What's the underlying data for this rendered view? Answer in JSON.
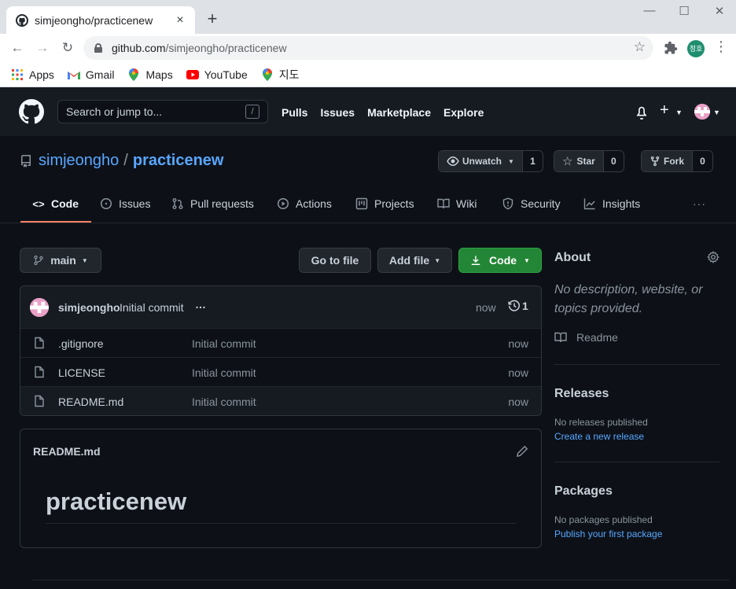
{
  "browser": {
    "tab_title": "simjeongho/practicenew",
    "tab_close": "×",
    "new_tab": "+",
    "url_host": "github.com",
    "url_path": "/simjeongho/practicenew",
    "profile_initials": "정호",
    "bookmarks": [
      {
        "label": "Apps",
        "icon": "apps-grid-icon"
      },
      {
        "label": "Gmail",
        "icon": "gmail-icon"
      },
      {
        "label": "Maps",
        "icon": "maps-pin-icon"
      },
      {
        "label": "YouTube",
        "icon": "youtube-icon"
      },
      {
        "label": "지도",
        "icon": "maps-pin-icon"
      }
    ]
  },
  "header": {
    "search_placeholder": "Search or jump to...",
    "search_shortcut": "/",
    "nav": [
      "Pulls",
      "Issues",
      "Marketplace",
      "Explore"
    ]
  },
  "repo": {
    "owner": "simjeongho",
    "separator": "/",
    "name": "practicenew",
    "watch_label": "Unwatch",
    "watch_count": "1",
    "star_label": "Star",
    "star_count": "0",
    "fork_label": "Fork",
    "fork_count": "0"
  },
  "tabs": [
    {
      "label": "Code",
      "icon": "code-icon"
    },
    {
      "label": "Issues",
      "icon": "issue-opened-icon"
    },
    {
      "label": "Pull requests",
      "icon": "git-pull-request-icon"
    },
    {
      "label": "Actions",
      "icon": "play-icon"
    },
    {
      "label": "Projects",
      "icon": "project-icon"
    },
    {
      "label": "Wiki",
      "icon": "book-icon"
    },
    {
      "label": "Security",
      "icon": "shield-icon"
    },
    {
      "label": "Insights",
      "icon": "graph-icon"
    }
  ],
  "tabs_more": "···",
  "toolbar": {
    "branch": "main",
    "go_to_file": "Go to file",
    "add_file": "Add file",
    "code": "Code"
  },
  "commit": {
    "author": "simjeongho",
    "message": "Initial commit",
    "more": "…",
    "when": "now",
    "history_count": "1"
  },
  "files": [
    {
      "name": ".gitignore",
      "message": "Initial commit",
      "when": "now"
    },
    {
      "name": "LICENSE",
      "message": "Initial commit",
      "when": "now"
    },
    {
      "name": "README.md",
      "message": "Initial commit",
      "when": "now"
    }
  ],
  "readme": {
    "filename": "README.md",
    "heading": "practicenew"
  },
  "sidebar": {
    "about_title": "About",
    "description": "No description, website, or topics provided.",
    "readme_label": "Readme",
    "releases_title": "Releases",
    "releases_empty": "No releases published",
    "releases_link": "Create a new release",
    "packages_title": "Packages",
    "packages_empty": "No packages published",
    "packages_link": "Publish your first package"
  },
  "colors": {
    "accent_link": "#58a6ff",
    "green_button": "#238636",
    "tab_underline": "#f78166",
    "page_bg": "#0d1117"
  }
}
